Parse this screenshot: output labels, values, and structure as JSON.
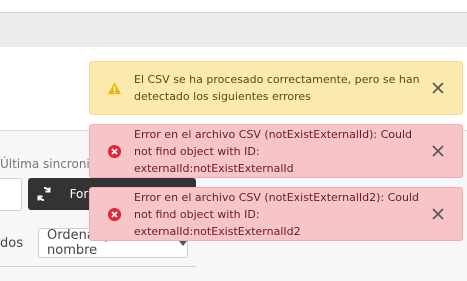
{
  "background": {
    "last_sync_text": "Última sincronizac",
    "force_button_label": "Forzar sincronización",
    "sort_label_fragment": "dos",
    "sort_select_value": "Ordenar por nombre"
  },
  "toasts": [
    {
      "type": "warning",
      "icon": "warning-icon",
      "message": "El CSV se ha procesado correctamente, pero se han detectado los siguientes errores",
      "color": "#fce9ad"
    },
    {
      "type": "error",
      "icon": "error-icon",
      "message": "Error en el archivo CSV (notExistExternalId): Could not find object with ID: externalId:notExistExternalId",
      "color": "#f7c4c8"
    },
    {
      "type": "error",
      "icon": "error-icon",
      "message": "Error en el archivo CSV (notExistExternalId2): Could not find object with ID: externalId:notExistExternalId2",
      "color": "#f7c4c8"
    }
  ],
  "colors": {
    "warning_icon": "#e6b800",
    "error_icon": "#e0283a",
    "close_icon": "#555555"
  }
}
